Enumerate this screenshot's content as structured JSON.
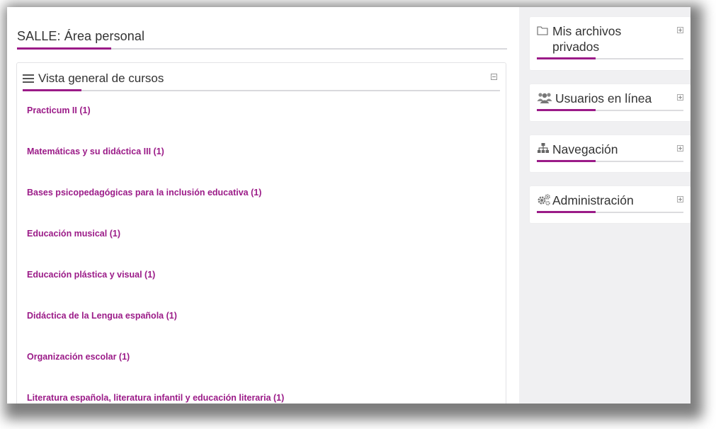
{
  "page": {
    "title": "SALLE: Área personal"
  },
  "courses_block": {
    "title": "Vista general de cursos",
    "courses": [
      "Practicum II (1)",
      "Matemáticas y su didáctica III (1)",
      "Bases psicopedagógicas para la inclusión educativa (1)",
      "Educación musical (1)",
      "Educación plástica y visual (1)",
      "Didáctica de la Lengua española (1)",
      "Organización escolar (1)",
      "Literatura española, literatura infantil y educación literaria (1)"
    ]
  },
  "sidebar": {
    "blocks": [
      {
        "title": "Mis archivos privados",
        "icon": "folder-icon"
      },
      {
        "title": "Usuarios en línea",
        "icon": "users-icon"
      },
      {
        "title": "Navegación",
        "icon": "sitemap-icon"
      },
      {
        "title": "Administración",
        "icon": "gears-icon"
      }
    ]
  },
  "colors": {
    "accent": "#9b1b88",
    "background": "#f0f0f2",
    "text": "#333333"
  }
}
